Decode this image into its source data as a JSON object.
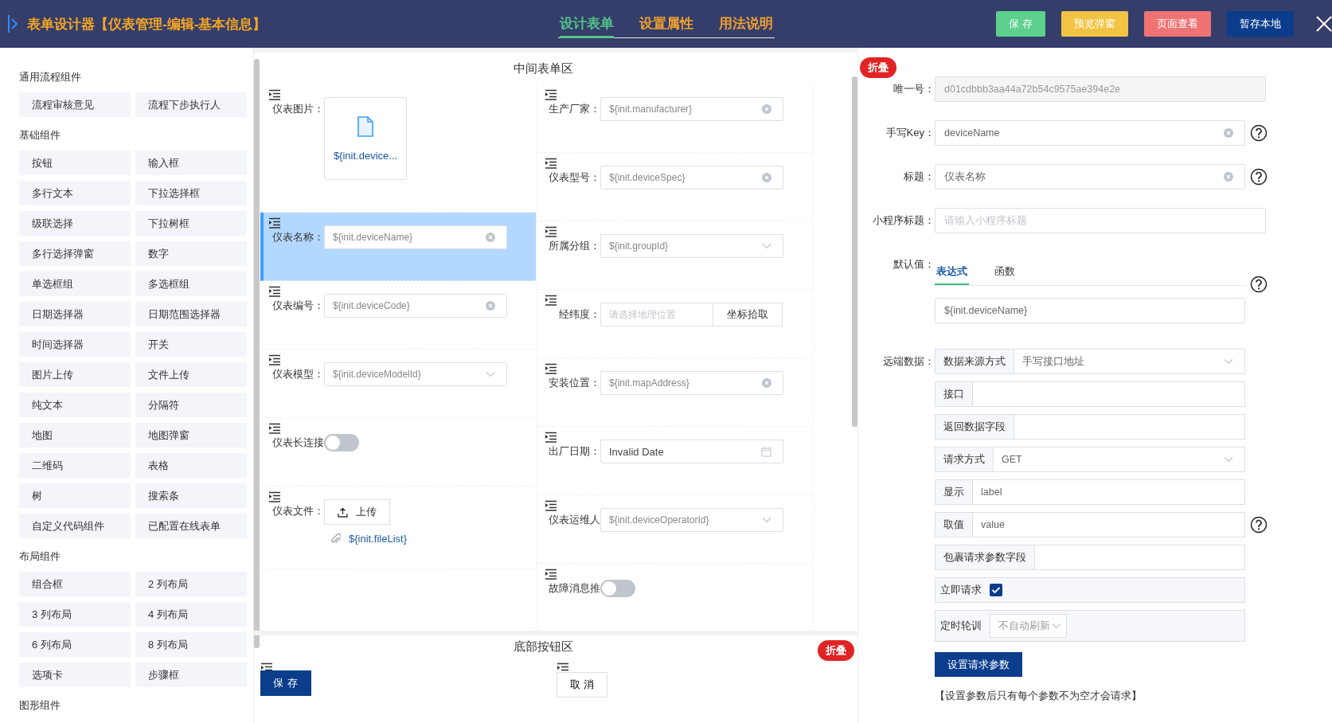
{
  "header": {
    "title": "表单设计器【仪表管理-编辑-基本信息】",
    "tabs": [
      {
        "label": "设计表单",
        "selected": true
      },
      {
        "label": "设置属性",
        "selected": false
      },
      {
        "label": "用法说明",
        "selected": false
      }
    ],
    "buttons": [
      {
        "label": "保 存",
        "color": "#5cd08c"
      },
      {
        "label": "预览弹窗",
        "color": "#f3c343"
      },
      {
        "label": "页面查看",
        "color": "#f07373"
      },
      {
        "label": "暂存本地",
        "color": "#0b3d8c"
      }
    ]
  },
  "palette": {
    "sections": [
      {
        "title": "通用流程组件",
        "items": [
          "流程审核意见",
          "流程下步执行人"
        ]
      },
      {
        "title": "基础组件",
        "items": [
          "按钮",
          "输入框",
          "多行文本",
          "下拉选择框",
          "级联选择",
          "下拉树框",
          "多行选择弹窗",
          "数字",
          "单选框组",
          "多选框组",
          "日期选择器",
          "日期范围选择器",
          "时间选择器",
          "开关",
          "图片上传",
          "文件上传",
          "纯文本",
          "分隔符",
          "地图",
          "地图弹窗",
          "二维码",
          "表格",
          "树",
          "搜索条",
          "自定义代码组件",
          "已配置在线表单"
        ]
      },
      {
        "title": "布局组件",
        "items": [
          "组合框",
          "2 列布局",
          "3 列布局",
          "4 列布局",
          "6 列布局",
          "8 列布局",
          "选项卡",
          "步骤框"
        ]
      },
      {
        "title": "图形组件"
      }
    ]
  },
  "canvas": {
    "title": "中间表单区",
    "columns": [
      [
        {
          "kind": "image",
          "label": "仪表图片：",
          "value": "${init.device...",
          "selected": false
        },
        {
          "kind": "input",
          "label": "仪表名称：",
          "value": "${init.deviceName}",
          "selected": true
        },
        {
          "kind": "input",
          "label": "仪表编号：",
          "value": "${init.deviceCode}",
          "selected": false
        },
        {
          "kind": "select",
          "label": "仪表模型：",
          "value": "${init.deviceModelId}",
          "selected": false
        },
        {
          "kind": "switch",
          "label": "仪表长连接",
          "on": false,
          "selected": false
        },
        {
          "kind": "upload",
          "label": "仪表文件：",
          "button": "上传",
          "file": "${init.fileList}",
          "selected": false
        }
      ],
      [
        {
          "kind": "input",
          "label": "生产厂家：",
          "value": "${init.manufacturer}",
          "selected": false
        },
        {
          "kind": "input",
          "label": "仪表型号：",
          "value": "${init.deviceSpec}",
          "selected": false
        },
        {
          "kind": "select",
          "label": "所属分组：",
          "value": "${init.groupId}",
          "selected": false
        },
        {
          "kind": "geo",
          "label": "经纬度：",
          "placeholder": "请选择地理位置",
          "button": "坐标拾取",
          "selected": false
        },
        {
          "kind": "input",
          "label": "安装位置：",
          "value": "${init.mapAddress}",
          "selected": false
        },
        {
          "kind": "date",
          "label": "出厂日期：",
          "value": "Invalid Date",
          "selected": false
        },
        {
          "kind": "select",
          "label": "仪表运维人",
          "value": "${init.deviceOperatorId}",
          "selected": false
        },
        {
          "kind": "switch",
          "label": "故障消息推",
          "on": false,
          "selected": false
        }
      ]
    ]
  },
  "footer": {
    "title": "底部按钮区",
    "collapse": "折叠",
    "buttons": [
      {
        "label": "保 存",
        "kind": "primary"
      },
      {
        "label": "取 消",
        "kind": "default"
      }
    ]
  },
  "props": {
    "collapse": "折叠",
    "fields": [
      {
        "kind": "readonly",
        "label": "唯一号：",
        "value": "d01cdbbb3aa44a72b54c9575ae394e2e"
      },
      {
        "kind": "input",
        "label": "手写Key：",
        "value": "deviceName",
        "clearable": true,
        "help": true
      },
      {
        "kind": "input",
        "label": "标题：",
        "value": "仪表名称",
        "clearable": true,
        "help": true
      },
      {
        "kind": "input",
        "label": "小程序标题：",
        "placeholder": "请输入小程序标题"
      },
      {
        "kind": "default",
        "label": "默认值：",
        "tabs": [
          {
            "label": "表达式",
            "selected": true
          },
          {
            "label": "函数",
            "selected": false
          }
        ],
        "value": "${init.deviceName}",
        "help": true
      },
      {
        "kind": "remote",
        "label": "远端数据：",
        "rows": [
          {
            "kind": "select",
            "addon": "数据来源方式",
            "value": "手写接口地址"
          },
          {
            "kind": "input",
            "addon": "接口"
          },
          {
            "kind": "input",
            "addon": "返回数据字段"
          },
          {
            "kind": "select",
            "addon": "请求方式",
            "value": "GET"
          },
          {
            "kind": "input",
            "addon": "显示",
            "value": "label"
          },
          {
            "kind": "input",
            "addon": "取值",
            "value": "value",
            "help": true
          },
          {
            "kind": "input",
            "addon": "包裹请求参数字段"
          },
          {
            "kind": "checkbox",
            "addon": "立即请求",
            "checked": true
          },
          {
            "kind": "poll",
            "addon": "定时轮训",
            "value": "不自动刷新"
          }
        ],
        "button": "设置请求参数",
        "note": "【设置参数后只有每个参数不为空才会请求】"
      }
    ]
  }
}
